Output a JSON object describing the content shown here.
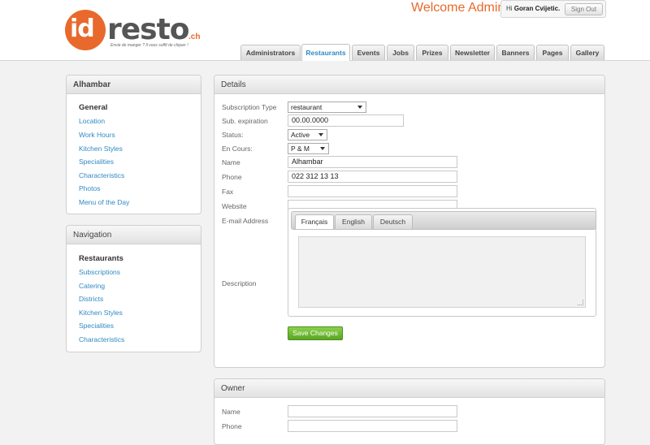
{
  "brand": {
    "id": "id",
    "word": "resto",
    "tld": ".ch",
    "tagline": "Envie de manger ? Il vous suffit de cliquer !"
  },
  "header": {
    "welcome": "Welcome Admin:",
    "hi_prefix": "Hi",
    "user_name": "Goran Cvijetic.",
    "signout_label": "Sign Out"
  },
  "nav_tabs": [
    "Administrators",
    "Restaurants",
    "Events",
    "Jobs",
    "Prizes",
    "Newsletter",
    "Banners",
    "Pages",
    "Gallery"
  ],
  "nav_active": "Restaurants",
  "restaurant_panel": {
    "title": "Alhambar",
    "items": [
      "General",
      "Location",
      "Work Hours",
      "Kitchen Styles",
      "Specialities",
      "Characteristics",
      "Photos",
      "Menu of the Day"
    ]
  },
  "navigation_panel": {
    "title": "Navigation",
    "items": [
      "Restaurants",
      "Subscriptions",
      "Catering",
      "Districts",
      "Kitchen Styles",
      "Specialities",
      "Characteristics"
    ]
  },
  "details": {
    "title": "Details",
    "labels": {
      "subscription_type": "Subscription Type",
      "sub_expiration": "Sub. expiration",
      "status": "Status:",
      "en_cours": "En Cours:",
      "name": "Name",
      "phone": "Phone",
      "fax": "Fax",
      "website": "Website",
      "email": "E-mail Address",
      "description": "Description"
    },
    "values": {
      "subscription_type": "restaurant",
      "sub_expiration": "00.00.0000",
      "status": "Active",
      "en_cours": "P & M",
      "name": "Alhambar",
      "phone": "022 312 13 13",
      "fax": "",
      "website": "",
      "email": ""
    },
    "lang_tabs": [
      "Français",
      "English",
      "Deutsch"
    ],
    "save_label": "Save Changes"
  },
  "owner": {
    "title": "Owner",
    "labels": {
      "name": "Name",
      "phone": "Phone"
    },
    "values": {
      "name": "",
      "phone": ""
    }
  },
  "colors": {
    "brand_orange": "#e8692b",
    "link_blue": "#2f8ac4",
    "save_green": "#5aa524"
  }
}
